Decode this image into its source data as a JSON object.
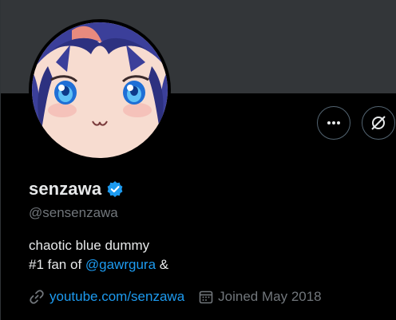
{
  "profile": {
    "display_name": "senzawa",
    "handle": "@sensenzawa",
    "verified": true,
    "bio_line1": "chaotic blue dummy",
    "bio_line2_prefix": "#1 fan of ",
    "bio_line2_mention": "@gawrgura",
    "bio_line2_suffix": " &",
    "website": "youtube.com/senzawa",
    "joined": "Joined May 2018"
  },
  "colors": {
    "background": "#000000",
    "banner": "#333639",
    "accent": "#1d9bf0",
    "muted_text": "#71767b",
    "primary_text": "#e7e9ea"
  },
  "icons": {
    "more": "more-horizontal-icon",
    "grok": "grok-icon",
    "verified": "verified-badge-icon",
    "link": "link-icon",
    "calendar": "calendar-icon"
  }
}
